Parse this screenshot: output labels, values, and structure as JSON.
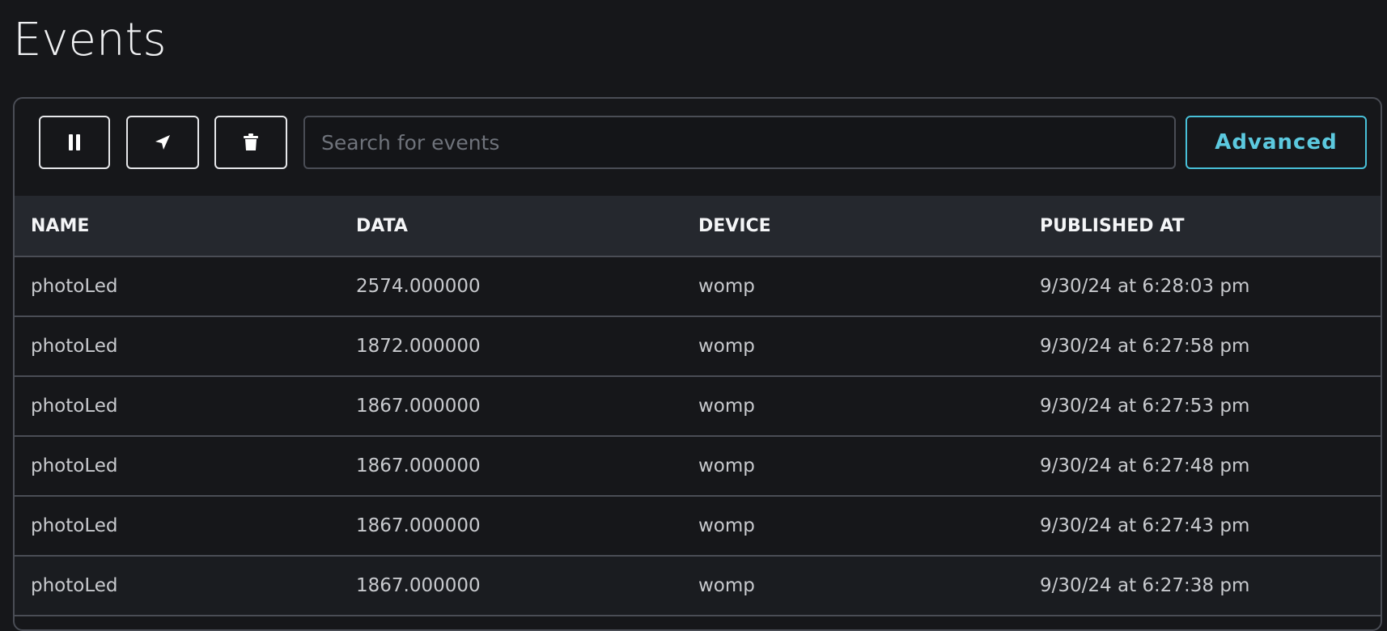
{
  "page": {
    "title": "Events"
  },
  "toolbar": {
    "pause_icon": "pause-icon",
    "publish_icon": "send-arrow-icon",
    "clear_icon": "trash-icon",
    "search_placeholder": "Search for events",
    "search_value": "",
    "advanced_label": "Advanced",
    "accent_color": "#48c0d8"
  },
  "table": {
    "columns": [
      "NAME",
      "DATA",
      "DEVICE",
      "PUBLISHED AT"
    ],
    "rows": [
      {
        "name": "photoLed",
        "data": "2574.000000",
        "device": "womp",
        "published_at": "9/30/24 at 6:28:03 pm"
      },
      {
        "name": "photoLed",
        "data": "1872.000000",
        "device": "womp",
        "published_at": "9/30/24 at 6:27:58 pm"
      },
      {
        "name": "photoLed",
        "data": "1867.000000",
        "device": "womp",
        "published_at": "9/30/24 at 6:27:53 pm"
      },
      {
        "name": "photoLed",
        "data": "1867.000000",
        "device": "womp",
        "published_at": "9/30/24 at 6:27:48 pm"
      },
      {
        "name": "photoLed",
        "data": "1867.000000",
        "device": "womp",
        "published_at": "9/30/24 at 6:27:43 pm"
      },
      {
        "name": "photoLed",
        "data": "1867.000000",
        "device": "womp",
        "published_at": "9/30/24 at 6:27:38 pm"
      }
    ]
  }
}
